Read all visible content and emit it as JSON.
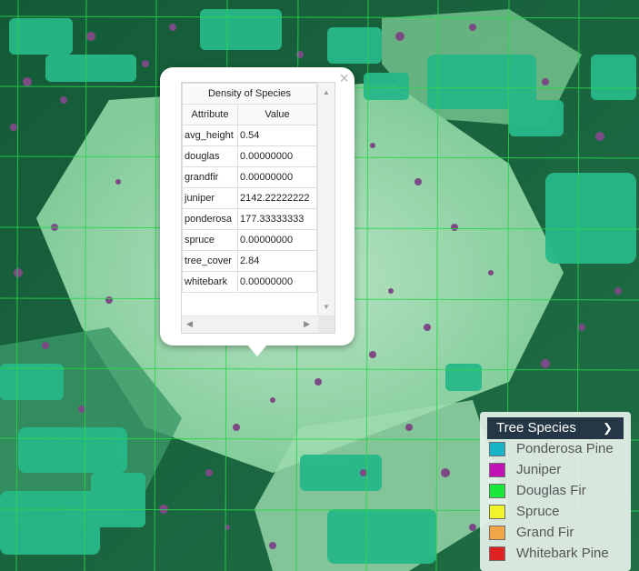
{
  "popup": {
    "title": "Density of Species",
    "columns": [
      "Attribute",
      "Value"
    ],
    "rows": [
      {
        "attribute": "avg_height",
        "value": "0.54"
      },
      {
        "attribute": "douglas",
        "value": "0.00000000"
      },
      {
        "attribute": "grandfir",
        "value": "0.00000000"
      },
      {
        "attribute": "juniper",
        "value": "2142.22222222"
      },
      {
        "attribute": "ponderosa",
        "value": "177.33333333"
      },
      {
        "attribute": "spruce",
        "value": "0.00000000"
      },
      {
        "attribute": "tree_cover",
        "value": "2.84"
      },
      {
        "attribute": "whitebark",
        "value": "0.00000000"
      }
    ],
    "close_icon": "×"
  },
  "legend": {
    "title": "Tree Species",
    "items": [
      {
        "label": "Ponderosa Pine",
        "color": "#18b4c8"
      },
      {
        "label": "Juniper",
        "color": "#c012b4"
      },
      {
        "label": "Douglas Fir",
        "color": "#18e83a"
      },
      {
        "label": "Spruce",
        "color": "#f0f52a"
      },
      {
        "label": "Grand Fir",
        "color": "#f3a646"
      },
      {
        "label": "Whitebark Pine",
        "color": "#df2222"
      }
    ]
  },
  "map": {
    "colors": {
      "dark_forest": "#1f6b43",
      "tree_canopy": "#27b889",
      "juniper_density": "#7c4b86",
      "meadow": "#a6e6b5",
      "grid_line": "#28d64a"
    }
  }
}
